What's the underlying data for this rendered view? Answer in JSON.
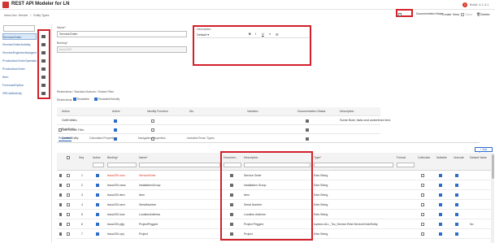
{
  "app": {
    "title": "REST API Modeler for LN",
    "badge": "2",
    "build": "Build: 4.1.4.1"
  },
  "breadcrumb": [
    "Inbox Dec. Service",
    "/",
    "Entity Types"
  ],
  "toolbar": {
    "doc_mode": "Documentation Mode",
    "create": "Create View",
    "save": "Save",
    "delete": "Delete"
  },
  "sidebar": {
    "search_placeholder": "",
    "items": [
      {
        "label": "ServiceOrder",
        "selected": true
      },
      {
        "label": "ServiceOrderActivity"
      },
      {
        "label": "ServiceEngineerAssignment"
      },
      {
        "label": "ProductionOrderOperation"
      },
      {
        "label": "ProductionOrder"
      },
      {
        "label": "Item"
      },
      {
        "label": "ForecastOption"
      },
      {
        "label": "SRCallActivity"
      }
    ]
  },
  "form": {
    "name_label": "Name",
    "name_value": "ServiceOrder",
    "binding_label": "Binding",
    "binding_value": "tssoc200",
    "description_label": "Description",
    "rte_style": "Default",
    "rte_bold": "B",
    "rte_italic": "I",
    "rte_underline": "U",
    "rte_list1": "≡",
    "rte_list2": "☰"
  },
  "restrictions": {
    "title": "Restrictions / Standard Actions / Subset Filter",
    "restrictions_label": "Restrictions:",
    "readable": "Readable",
    "readable_modify": "Readable/Modify",
    "headers": [
      "Action",
      "Active",
      "Identity Function",
      "Dic.",
      "Variation",
      "Documentation Status",
      "Description"
    ],
    "rows": [
      {
        "action": "GetEntities",
        "active": true,
        "identity": false,
        "doc": "",
        "desc": "Some Bold, Italic and underlined text."
      },
      {
        "action": "PostEntity",
        "active": true,
        "identity": false,
        "doc": "",
        "desc": ""
      },
      {
        "action": "DeleteEntity",
        "active": true,
        "identity": false,
        "doc": "",
        "desc": ""
      }
    ],
    "add_filter": "Add Subset Filter"
  },
  "tabs": [
    "Properties",
    "Calculated Properties",
    "Navigation Properties",
    "Included Enum Types"
  ],
  "grid": {
    "add_property": "+ Add Property",
    "headers": [
      "Seq",
      "Active",
      "Binding",
      "Name",
      "Documen...",
      "Description",
      "Type",
      "Format",
      "Collection",
      "Nullable",
      "Unicode",
      "Default Value"
    ],
    "rows": [
      {
        "seq": "1",
        "binding": "tssoc200.orno",
        "name": "ServiceOrder",
        "desc": "Service Order",
        "type": "Edm.String",
        "default": ""
      },
      {
        "seq": "2",
        "binding": "tssoc200.cwoc",
        "name": "InstallationGroup",
        "desc": "Installation Group",
        "type": "Edm.String",
        "default": ""
      },
      {
        "seq": "3",
        "binding": "tssoc200.item",
        "name": "Item",
        "desc": "Item",
        "type": "Edm.String",
        "default": ""
      },
      {
        "seq": "4",
        "binding": "tssoc200.sern",
        "name": "SerialNumber",
        "desc": "Serial Number",
        "type": "Edm.String",
        "default": ""
      },
      {
        "seq": "5",
        "binding": "tssoc200.loca",
        "name": "LocationAddress",
        "desc": "Location Address",
        "type": "Edm.String",
        "default": ""
      },
      {
        "seq": "6",
        "binding": "tssoc200.pjtg",
        "name": "ProjectPegged",
        "desc": "Project Pegged",
        "type": "tcyesno.ALL_Tcs_Service.Rest.ServiceOrderEntity",
        "default": "No"
      },
      {
        "seq": "7",
        "binding": "tssoc200.cprj",
        "name": "Project",
        "desc": "Project",
        "type": "Edm.String",
        "default": ""
      }
    ]
  }
}
